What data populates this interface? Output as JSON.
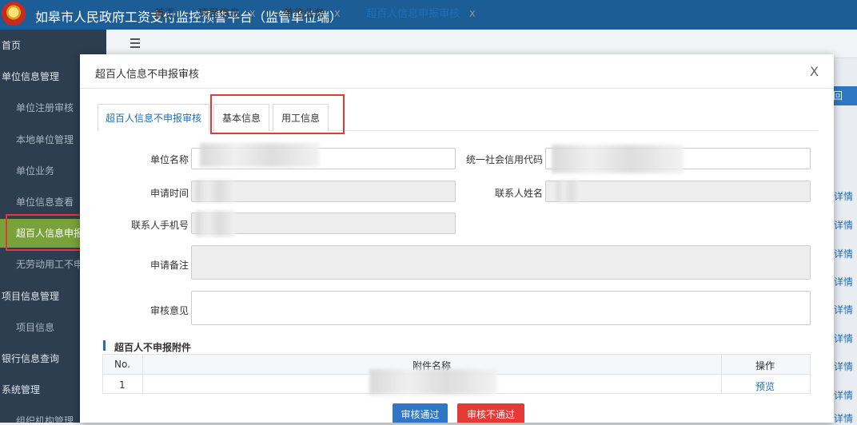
{
  "app": {
    "title": "如皋市人民政府工资支付监控预警平台（监管单位端）"
  },
  "sidebar": {
    "items": [
      {
        "label": "首页",
        "level": 1
      },
      {
        "label": "单位信息管理",
        "level": 1
      },
      {
        "label": "单位注册审核",
        "level": 2
      },
      {
        "label": "本地单位管理",
        "level": 2
      },
      {
        "label": "单位业务",
        "level": 2
      },
      {
        "label": "单位信息查看",
        "level": 2
      },
      {
        "label": "超百人信息申报",
        "level": 2,
        "active": true
      },
      {
        "label": "无劳动用工不申",
        "level": 2
      },
      {
        "label": "项目信息管理",
        "level": 1
      },
      {
        "label": "项目信息",
        "level": 2
      },
      {
        "label": "银行信息查询",
        "level": 1
      },
      {
        "label": "系统管理",
        "level": 1
      },
      {
        "label": "组织机构管理",
        "level": 2
      }
    ]
  },
  "tabs": [
    {
      "label": "首页",
      "closable": false
    },
    {
      "label": "项目信息",
      "closable": true
    },
    {
      "label": "单位业务",
      "closable": true
    },
    {
      "label": "超百人信息申报审核",
      "closable": true,
      "active": true
    }
  ],
  "background": {
    "button_label": "回",
    "link_label": "详情"
  },
  "modal": {
    "title": "超百人信息不申报审核",
    "close": "X",
    "tabs": [
      "超百人信息不申报审核",
      "基本信息",
      "用工信息"
    ],
    "form": {
      "unit_name_label": "单位名称",
      "credit_code_label": "统一社会信用代码",
      "apply_time_label": "申请时间",
      "contact_name_label": "联系人姓名",
      "contact_phone_label": "联系人手机号",
      "apply_note_label": "申请备注",
      "review_opinion_label": "审核意见"
    },
    "attachments": {
      "section_title": "超百人不申报附件",
      "columns": {
        "no": "No.",
        "name": "附件名称",
        "op": "操作"
      },
      "rows": [
        {
          "no": "1",
          "action": "预览"
        }
      ]
    },
    "buttons": {
      "approve": "审核通过",
      "reject": "审核不通过"
    }
  }
}
